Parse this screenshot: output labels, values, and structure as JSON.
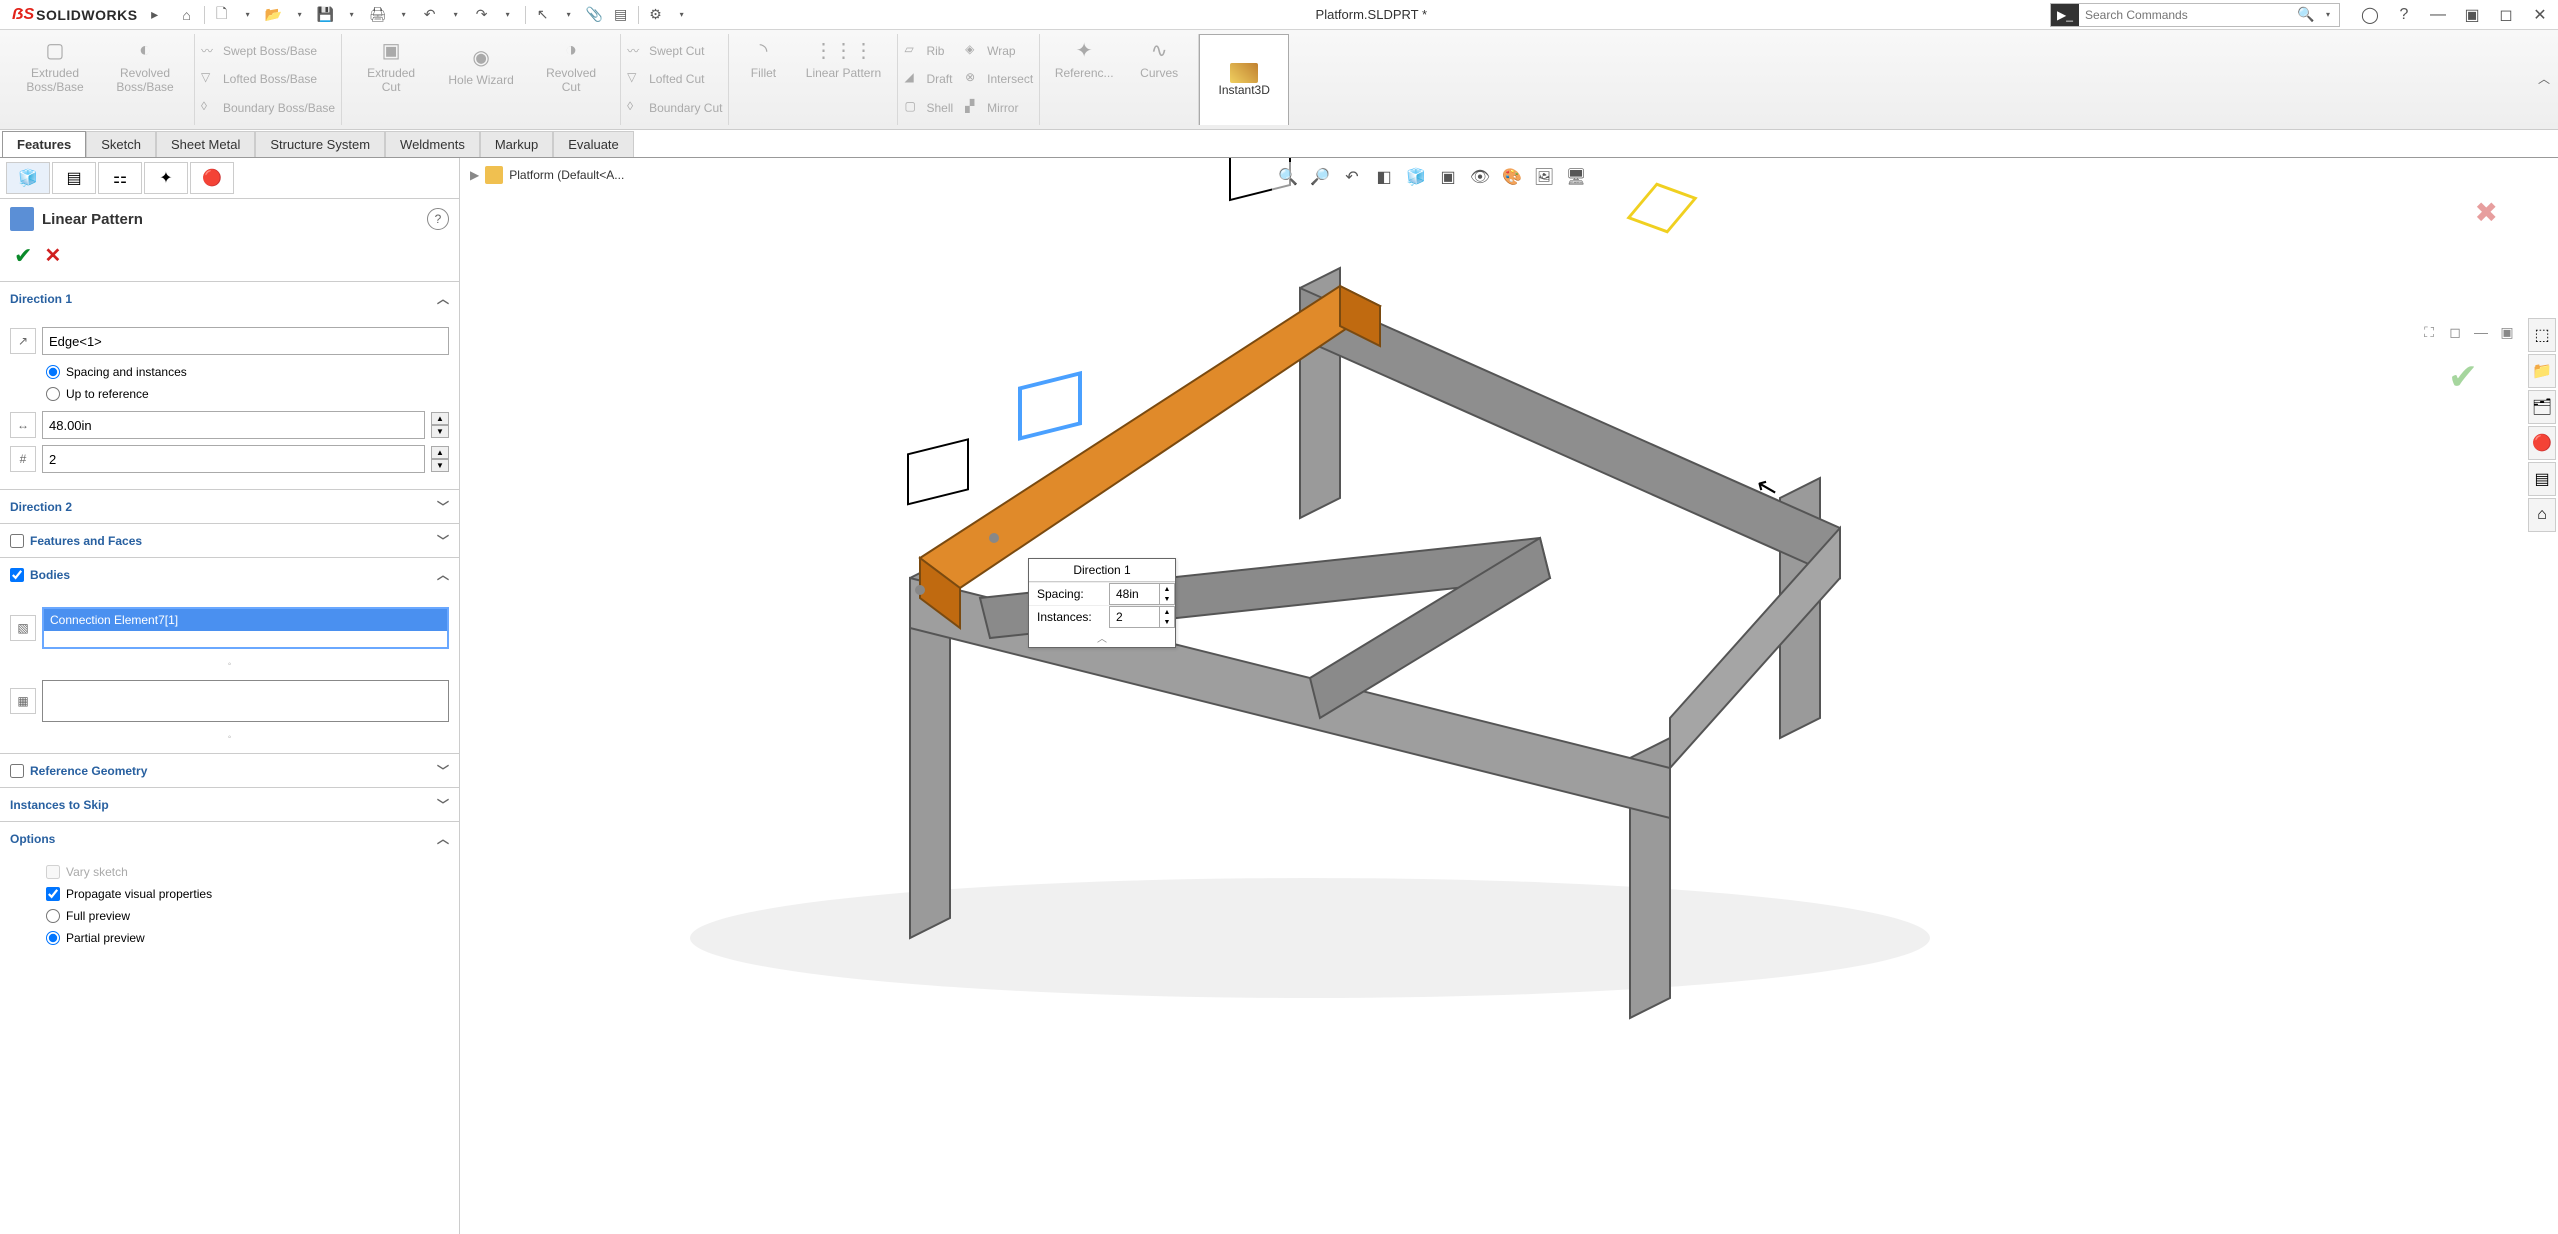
{
  "app": {
    "brand_prefix": "S",
    "brand": "SOLIDWORKS",
    "document_title": "Platform.SLDPRT *",
    "search_placeholder": "Search Commands"
  },
  "ribbon": {
    "groups": {
      "extruded_boss": "Extruded\nBoss/Base",
      "revolved_boss": "Revolved\nBoss/Base",
      "swept_boss": "Swept Boss/Base",
      "lofted_boss": "Lofted Boss/Base",
      "boundary_boss": "Boundary Boss/Base",
      "extruded_cut": "Extruded\nCut",
      "hole_wizard": "Hole Wizard",
      "revolved_cut": "Revolved\nCut",
      "swept_cut": "Swept Cut",
      "lofted_cut": "Lofted Cut",
      "boundary_cut": "Boundary Cut",
      "fillet": "Fillet",
      "linear_pattern": "Linear Pattern",
      "rib": "Rib",
      "draft": "Draft",
      "shell": "Shell",
      "wrap": "Wrap",
      "intersect": "Intersect",
      "mirror": "Mirror",
      "reference": "Referenc...",
      "curves": "Curves",
      "instant3d": "Instant3D"
    }
  },
  "tabs": {
    "features": "Features",
    "sketch": "Sketch",
    "sheet_metal": "Sheet Metal",
    "structure_system": "Structure System",
    "weldments": "Weldments",
    "markup": "Markup",
    "evaluate": "Evaluate"
  },
  "breadcrumb": "Platform (Default<A...",
  "pm": {
    "title": "Linear Pattern",
    "direction1": {
      "header": "Direction 1",
      "selection": "Edge<1>",
      "spacing_radio": "Spacing and instances",
      "upto_radio": "Up to reference",
      "spacing_value": "48.00in",
      "instances_value": "2"
    },
    "direction2": {
      "header": "Direction 2"
    },
    "features_faces": {
      "header": "Features and Faces"
    },
    "bodies": {
      "header": "Bodies",
      "selected": "Connection Element7[1]"
    },
    "ref_geom": {
      "header": "Reference Geometry"
    },
    "skip": {
      "header": "Instances to Skip"
    },
    "options": {
      "header": "Options",
      "vary_sketch": "Vary sketch",
      "propagate": "Propagate visual properties",
      "full_preview": "Full preview",
      "partial_preview": "Partial preview"
    }
  },
  "callout": {
    "title": "Direction  1",
    "spacing_label": "Spacing:",
    "spacing_value": "48in",
    "instances_label": "Instances:",
    "instances_value": "2"
  }
}
